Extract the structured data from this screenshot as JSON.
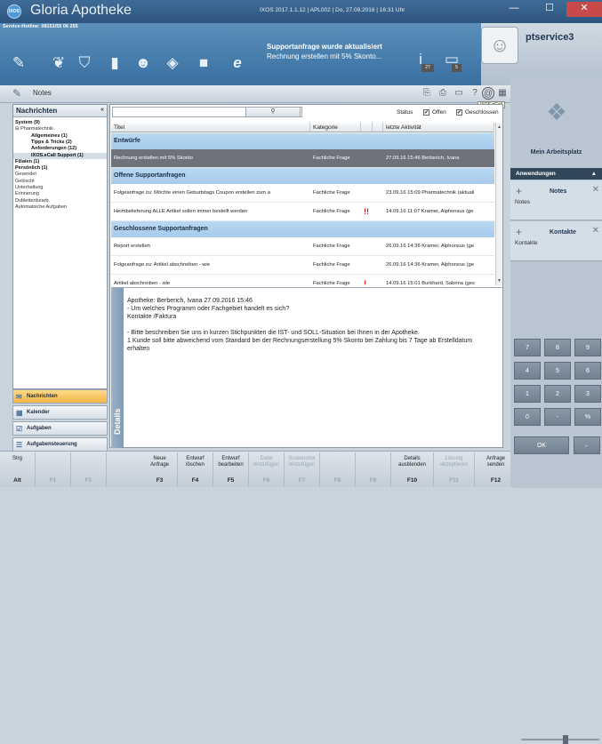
{
  "window": {
    "title": "Gloria Apotheke",
    "logo_text": "IXOS",
    "info": "IXOS 2017.1.1.12  |  APL002  |  Do, 27.09.2016  |  16:31 Uhr",
    "minimize": "—",
    "maximize": "☐",
    "close": "✕"
  },
  "toolbar": {
    "hotline": "Service-Hotline: 08151/55 06 255",
    "notification_title": "Supportanfrage wurde aktualisiert",
    "notification_text": "Rechnung erstellen mit 5% Skonto...",
    "badge_1": "27",
    "badge_2": "5"
  },
  "user": {
    "name": "ptservice3"
  },
  "module": {
    "title": "Notes",
    "tooltip": "IXOS.eCall"
  },
  "left_panel": {
    "header": "Nachrichten",
    "collapse": "«",
    "tree": [
      {
        "label": "System (9)",
        "bold": true,
        "indent": 0
      },
      {
        "label": "⊟ Pharmatechnik",
        "bold": false,
        "indent": 0
      },
      {
        "label": "Allgemeines (1)",
        "bold": true,
        "indent": 2
      },
      {
        "label": "Tipps & Tricks (2)",
        "bold": true,
        "indent": 2
      },
      {
        "label": "Anforderungen (12)",
        "bold": true,
        "indent": 2
      },
      {
        "label": "IXOS.eCall Support (1)",
        "bold": true,
        "indent": 2,
        "selected": true
      },
      {
        "label": "Filialen (1)",
        "bold": true,
        "indent": 0
      },
      {
        "label": "Persönlich (1)",
        "bold": true,
        "indent": 0
      },
      {
        "label": "Gesendet",
        "bold": false,
        "indent": 0
      },
      {
        "label": "Gelöscht",
        "bold": false,
        "indent": 0
      },
      {
        "label": "Unterhaltung",
        "bold": false,
        "indent": 0
      },
      {
        "label": "Erinnerung",
        "bold": false,
        "indent": 0
      },
      {
        "label": "Dublettenbearb.",
        "bold": false,
        "indent": 0
      },
      {
        "label": "Automatische Aufgaben",
        "bold": false,
        "indent": 0
      }
    ],
    "nav": [
      "Nachrichten",
      "Kalender",
      "Aufgaben",
      "Aufgabensteuerung"
    ]
  },
  "filter": {
    "search_icon": "magnifier-icon",
    "status_label": "Status",
    "open_label": "Offen",
    "closed_label": "Geschlossen",
    "check": "✔"
  },
  "grid": {
    "columns": [
      "Titel",
      "Kategorie",
      "",
      "",
      "letzte Aktivität"
    ],
    "groups": [
      {
        "name": "Entwürfe",
        "rows": [
          {
            "title": "Rechnung erstellen mit 5% Skonto",
            "category": "Fachliche Frage",
            "flag": "",
            "activity": "27.09.16 15:46 Berberich, Ivana",
            "selected": true
          }
        ]
      },
      {
        "name": "Offene Supportanfragen",
        "rows": [
          {
            "title": "Folgeanfrage zu: Möchte einen Geburtstags Coupon erstellen zum a",
            "category": "Fachliche Frage",
            "flag": "",
            "activity": "23.09.16 15:09 Pharmatechnik (aktuali"
          },
          {
            "title": "Heimbelieferung ALLE Artikel sollen immer bestellt werden",
            "category": "Fachliche Frage",
            "flag": "!!",
            "activity": "14.09.16 11:07 Kramer, Alphonsus (ge"
          }
        ]
      },
      {
        "name": "Geschlossene Supportanfragen",
        "rows": [
          {
            "title": "Report erstellen",
            "category": "Fachliche Frage",
            "flag": "",
            "activity": "26.09.16 14:36 Kramer, Alphonsus (ge"
          },
          {
            "title": "Folgeanfrage zu: Artikel abschreiben - wie",
            "category": "Fachliche Frage",
            "flag": "",
            "activity": "26.09.16 14:36 Kramer, Alphonsus (ge"
          },
          {
            "title": "Artikel abschreiben - wie",
            "category": "Fachliche Frage",
            "flag": "!",
            "activity": "14.09.16 15:01 Burkhard, Sabrina (ges"
          }
        ]
      }
    ]
  },
  "details": {
    "tab_label": "Details",
    "text": "Apotheke: Berberich, Ivana 27.09.2016 15:46\n- Um welches Programm oder Fachgebiet handelt es sich?\nKontakte /Faktura\n\n- Bitte beschreiben Sie uns in kurzen Stichpunkten die IST- und SOLL-Situation bei Ihnen in der Apotheke.\n1 Kunde soll bitte abweichend vom Standard bei der Rechnungserstellung 5% Skonto bei Zahlung bis 7 Tage ab Erstelldatum erhalten"
  },
  "fkeys": [
    {
      "label": "Strg",
      "code": "Alt",
      "disabled": false
    },
    {
      "label": "",
      "code": "F1",
      "disabled": true
    },
    {
      "label": "",
      "code": "F2",
      "disabled": true
    },
    {
      "label": "Neue\nAnfrage",
      "code": "F3",
      "disabled": false
    },
    {
      "label": "Entwurf\nlöschen",
      "code": "F4",
      "disabled": false
    },
    {
      "label": "Entwurf\nbearbeiten",
      "code": "F5",
      "disabled": false
    },
    {
      "label": "Datei\nhinzufügen",
      "code": "F6",
      "disabled": true
    },
    {
      "label": "Screenshot\nhinzufügen",
      "code": "F7",
      "disabled": true
    },
    {
      "label": "",
      "code": "F8",
      "disabled": true
    },
    {
      "label": "",
      "code": "F9",
      "disabled": true
    },
    {
      "label": "Details\nausblenden",
      "code": "F10",
      "disabled": false
    },
    {
      "label": "Lösung\nakzeptieren",
      "code": "F11",
      "disabled": true
    },
    {
      "label": "Anfrage\nsenden",
      "code": "F12",
      "disabled": false
    }
  ],
  "right_panel": {
    "workspace_label": "Mein Arbeitsplatz",
    "apps_header": "Anwendungen",
    "apps_collapse": "▲",
    "apps": [
      {
        "title": "Notes",
        "subtitle": "Notes"
      },
      {
        "title": "Kontakte",
        "subtitle": "Kontakte"
      }
    ],
    "keys": [
      "7",
      "8",
      "9",
      "4",
      "5",
      "6",
      "1",
      "2",
      "3",
      "0",
      "-",
      "%"
    ],
    "ok": "OK",
    "back": "←"
  },
  "colors": {
    "titlebar": "#2c557f",
    "group_band": "#a6cbec",
    "selected_row": "#6d7379",
    "active_nav": "#f3b445",
    "flag": "#e02020"
  }
}
